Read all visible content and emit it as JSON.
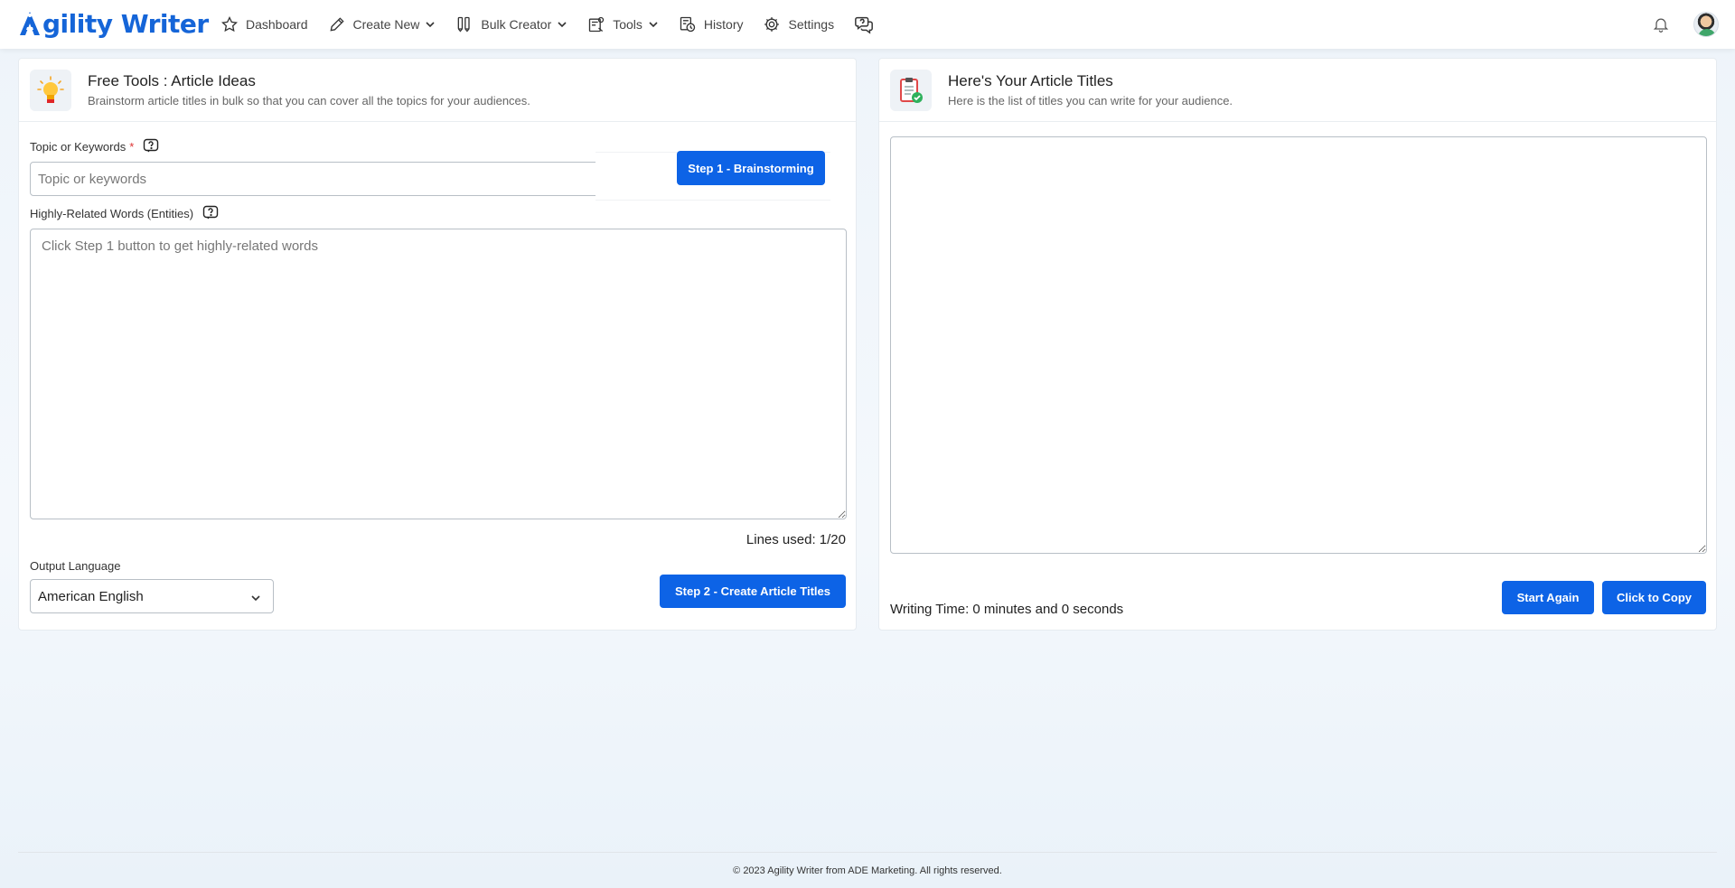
{
  "brand": {
    "logo_text": "gility Writer",
    "accent": "#0d63e6",
    "logo_color": "#1565d8"
  },
  "nav": {
    "items": [
      {
        "label": "Dashboard",
        "icon": "star-icon"
      },
      {
        "label": "Create New",
        "icon": "pencil-icon",
        "dropdown": true
      },
      {
        "label": "Bulk Creator",
        "icon": "pens-icon",
        "dropdown": true
      },
      {
        "label": "Tools",
        "icon": "tools-icon",
        "dropdown": true
      },
      {
        "label": "History",
        "icon": "history-icon"
      },
      {
        "label": "Settings",
        "icon": "gear-icon"
      }
    ],
    "help_icon": "chat-help-icon",
    "notification_icon": "bell-icon",
    "avatar_icon": "avatar"
  },
  "left_panel": {
    "title": "Free Tools : Article Ideas",
    "subtitle": "Brainstorm article titles in bulk so that you can cover all the topics for your audiences.",
    "icon": "lightbulb-icon",
    "topic_label": "Topic or Keywords",
    "topic_required": "*",
    "topic_placeholder": "Topic or keywords",
    "topic_value": "",
    "step1_label": "Step 1 - Brainstorming",
    "entities_label": "Highly-Related Words (Entities)",
    "entities_placeholder": "Click Step 1 button to get highly-related words",
    "lines_used": "Lines used: 1/20",
    "language_label": "Output Language",
    "language_value": "American English",
    "step2_label": "Step 2 - Create Article Titles"
  },
  "right_panel": {
    "title": "Here's Your Article Titles",
    "subtitle": "Here is the list of titles you can write for your audience.",
    "icon": "clipboard-check-icon",
    "output_value": "",
    "writing_time": "Writing Time: 0 minutes and 0 seconds",
    "start_again_label": "Start Again",
    "copy_label": "Click to Copy"
  },
  "footer": {
    "text": "© 2023 Agility Writer from ADE Marketing. All rights reserved."
  }
}
